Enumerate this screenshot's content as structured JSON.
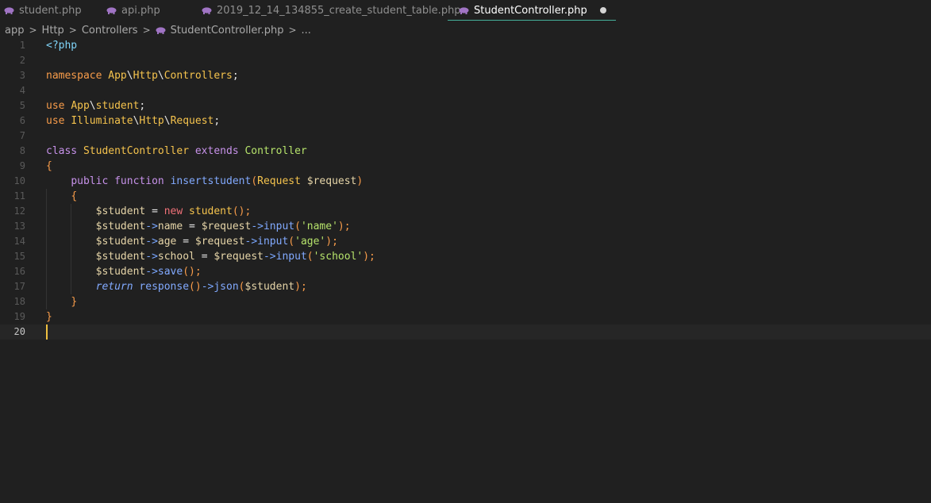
{
  "tabs": [
    {
      "label": "student.php",
      "active": false
    },
    {
      "label": "api.php",
      "active": false
    },
    {
      "label": "2019_12_14_134855_create_student_table.php",
      "active": false
    },
    {
      "label": "StudentController.php",
      "active": true,
      "dirty": true
    }
  ],
  "breadcrumb": {
    "items": [
      "app",
      "Http",
      "Controllers",
      "StudentController.php",
      "..."
    ]
  },
  "editor": {
    "cursor_line": 20,
    "lines": [
      {
        "num": "1"
      },
      {
        "num": "2"
      },
      {
        "num": "3"
      },
      {
        "num": "4"
      },
      {
        "num": "5"
      },
      {
        "num": "6"
      },
      {
        "num": "7"
      },
      {
        "num": "8"
      },
      {
        "num": "9"
      },
      {
        "num": "10"
      },
      {
        "num": "11"
      },
      {
        "num": "12"
      },
      {
        "num": "13"
      },
      {
        "num": "14"
      },
      {
        "num": "15"
      },
      {
        "num": "16"
      },
      {
        "num": "17"
      },
      {
        "num": "18"
      },
      {
        "num": "19"
      },
      {
        "num": "20"
      }
    ],
    "tokens": {
      "php_open": "<?php",
      "namespace_kw": "namespace",
      "ns_app": "App",
      "ns_http": "Http",
      "ns_controllers": "Controllers",
      "use_kw": "use",
      "student_cls": "student",
      "illuminate": "Illuminate",
      "request_cls": "Request",
      "class_kw": "class",
      "class_name": "StudentController",
      "extends_kw": "extends",
      "parent_cls": "Controller",
      "public_kw": "public",
      "function_kw": "function",
      "method_name": "insertstudent",
      "param_var": "$request",
      "student_var": "$student",
      "new_kw": "new",
      "name_prop": "name",
      "age_prop": "age",
      "school_prop": "school",
      "input_fn": "input",
      "str_name": "'name'",
      "str_age": "'age'",
      "str_school": "'school'",
      "save_fn": "save",
      "return_kw": "return",
      "response_fn": "response",
      "json_fn": "json"
    }
  },
  "colors": {
    "background": "#202020",
    "tab_accent": "#4ec9b0",
    "caret": "#f0c040",
    "php_icon": "#a074c4"
  },
  "icons": [
    "php-elephant-icon",
    "chevron-right-icon",
    "unsaved-dot-icon"
  ]
}
